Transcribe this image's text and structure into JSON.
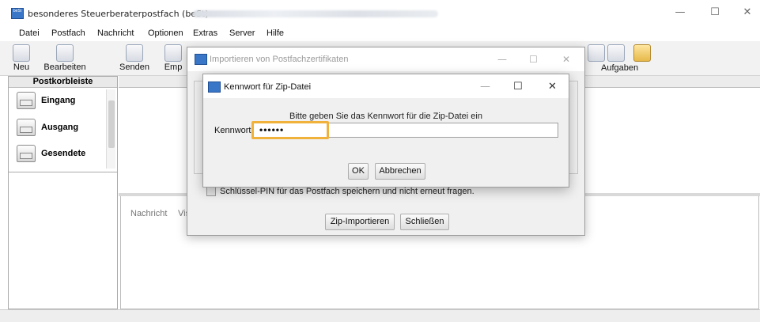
{
  "window": {
    "logo_text": "beSt",
    "title": "besonderes Steuerberaterpostfach (beSt)",
    "minimize": "—",
    "maximize": "☐",
    "close": "✕"
  },
  "menu": [
    "Datei",
    "Postfach",
    "Nachricht",
    "Optionen",
    "Extras",
    "Server",
    "Hilfe"
  ],
  "toolbar": {
    "new": "Neu",
    "edit": "Bearbeiten",
    "send": "Senden",
    "receive_partial": "Emp",
    "tasks": "Aufgaben"
  },
  "sidebar": {
    "header": "Postkorbleiste",
    "items": [
      {
        "label": "Eingang",
        "icon": "inbox-icon"
      },
      {
        "label": "Ausgang",
        "icon": "outbox-icon"
      },
      {
        "label": "Gesendete",
        "icon": "sent-icon"
      }
    ]
  },
  "main": {
    "tabs": [
      "Nachricht",
      "Vis"
    ]
  },
  "import_dialog": {
    "title": "Importieren von Postfachzertifikaten",
    "checkbox_label": "Schlüssel-PIN für das Postfach speichern und nicht erneut fragen.",
    "checkbox_checked": false,
    "import_button": "Zip-Importieren",
    "close_button": "Schließen"
  },
  "password_dialog": {
    "title": "Kennwort für Zip-Datei",
    "prompt": "Bitte geben Sie das Kennwort für die Zip-Datei ein",
    "label": "Kennwort",
    "masked_value": "••••••",
    "ok_button": "OK",
    "cancel_button": "Abbrechen",
    "minimize": "—",
    "maximize": "☐",
    "close": "✕"
  },
  "colors": {
    "highlight": "#f0b23a",
    "logo": "#3a76c7"
  }
}
